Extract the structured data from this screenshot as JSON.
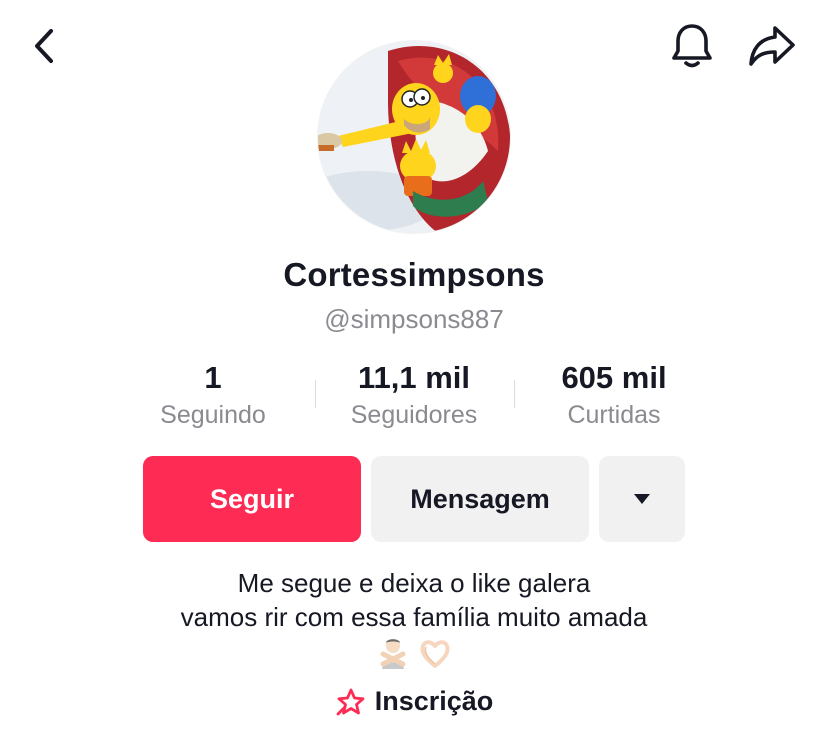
{
  "header": {
    "back_icon": "chevron-left-icon",
    "bell_icon": "bell-icon",
    "share_icon": "share-arrow-icon"
  },
  "profile": {
    "display_name": "Cortessimpsons",
    "username": "@simpsons887",
    "avatar": "simpsons-cartoon-avatar"
  },
  "stats": [
    {
      "value": "1",
      "label": "Seguindo"
    },
    {
      "value": "11,1 mil",
      "label": "Seguidores"
    },
    {
      "value": "605 mil",
      "label": "Curtidas"
    }
  ],
  "actions": {
    "follow_label": "Seguir",
    "message_label": "Mensagem",
    "more_icon": "caret-down-icon"
  },
  "bio": {
    "line1": "Me segue e deixa o like galera",
    "line2": "vamos rir com essa família muito amada",
    "emojis": [
      "person-gesturing-no-emoji",
      "heart-hands-emoji"
    ]
  },
  "link": {
    "label": "Inscrição",
    "icon": "subscription-star-icon"
  },
  "colors": {
    "accent": "#fe2c55",
    "text_primary": "#161823",
    "text_secondary": "#8a8b91",
    "button_secondary_bg": "#f1f1f2"
  }
}
